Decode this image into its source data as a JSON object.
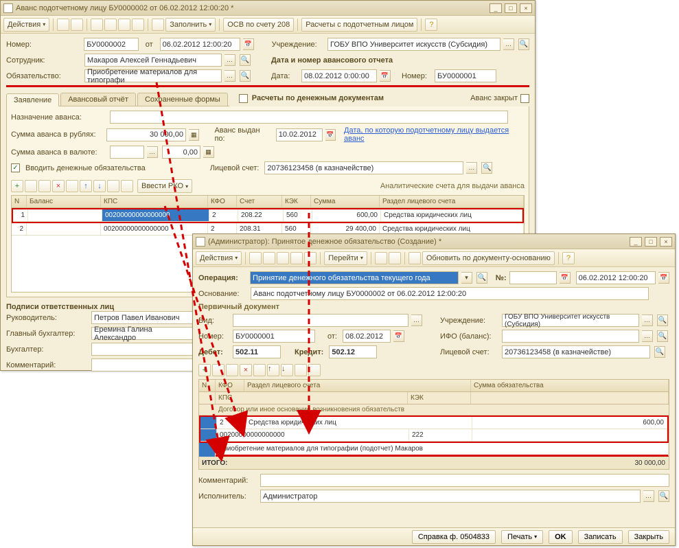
{
  "w1": {
    "title": "Аванс подотчетному лицу БУ0000002 от 06.02.2012 12:00:20 *",
    "toolbar": {
      "actions": "Действия",
      "fill": "Заполнить",
      "osv": "ОСВ по счету 208",
      "calc": "Расчеты с подотчетным лицом"
    },
    "nomer_lbl": "Номер:",
    "nomer": "БУ0000002",
    "ot_lbl": "от",
    "ot_date": "06.02.2012 12:00:20",
    "uchr_lbl": "Учреждение:",
    "uchr": "ГОБУ ВПО Университет искусств (Субсидия)",
    "sotr_lbl": "Сотрудник:",
    "sotr": "Макаров Алексей Геннадьевич",
    "avrep_title": "Дата и номер авансового отчета",
    "oblig_lbl": "Обязательство:",
    "oblig": "Приобретение материалов для типографи",
    "date_lbl": "Дата:",
    "date2": "08.02.2012 0:00:00",
    "nomer2_lbl": "Номер:",
    "nomer2": "БУ0000001",
    "tabs": {
      "t1": "Заявление",
      "t2": "Авансовый отчёт",
      "t3": "Сохраненные формы"
    },
    "rbd_lbl": "Расчеты по денежным документам",
    "closed_lbl": "Аванс закрыт",
    "nazn_lbl": "Назначение аванса:",
    "sum_rub_lbl": "Сумма аванса в рублях:",
    "sum_rub": "30 000,00",
    "vydan_lbl": "Аванс выдан по:",
    "vydan": "10.02.2012",
    "vydan_hint": "Дата, по которую подотчетному лицу выдается аванс",
    "sum_val_lbl": "Сумма аванса в валюте:",
    "sum_val": "0,00",
    "vvod_lbl": "Вводить денежные обязательства",
    "lich_lbl": "Лицевой счет:",
    "lich": "20736123458 (в казначействе)",
    "vvesti": "Ввести РКО",
    "anal": "Аналитические счета для выдачи аванса",
    "cols": {
      "n": "N",
      "bal": "Баланс",
      "kps": "КПС",
      "kfo": "КФО",
      "schet": "Счет",
      "kek": "КЭК",
      "sum": "Сумма",
      "razdel": "Раздел лицевого счета"
    },
    "rows": [
      {
        "n": "1",
        "bal": "",
        "kps": "00200000000000000",
        "kfo": "2",
        "schet": "208.22",
        "kek": "560",
        "sum": "600,00",
        "razdel": "Средства юридических лиц"
      },
      {
        "n": "2",
        "bal": "",
        "kps": "00200000000000000",
        "kfo": "2",
        "schet": "208.31",
        "kek": "560",
        "sum": "29 400,00",
        "razdel": "Средства юридических лиц"
      }
    ],
    "sig_title": "Подписи ответственных лиц",
    "ruk_lbl": "Руководитель:",
    "ruk": "Петров Павел Иванович",
    "gb_lbl": "Главный бухгалтер:",
    "gb": "Еремина Галина Александро",
    "buh_lbl": "Бухгалтер:",
    "kom_lbl": "Комментарий:"
  },
  "w2": {
    "title": "(Администратор): Принятое денежное обязательство (Создание) *",
    "toolbar": {
      "actions": "Действия",
      "goto": "Перейти",
      "refresh": "Обновить по документу-основанию"
    },
    "op_lbl": "Операция:",
    "op": "Принятие денежного обязательства текущего года",
    "num_lbl": "№:",
    "date": "06.02.2012 12:00:20",
    "osn_lbl": "Основание:",
    "osn": "Аванс подотчетному лицу БУ0000002 от 06.02.2012 12:00:20",
    "prim_title": "Первичный документ",
    "vid_lbl": "Вид:",
    "nomer_lbl": "Номер:",
    "nomer": "БУ0000001",
    "ot_lbl": "от:",
    "ot": "08.02.2012",
    "deb_lbl": "Дебет:",
    "deb": "502.11",
    "kred_lbl": "Кредит:",
    "kred": "502.12",
    "uchr_lbl": "Учреждение:",
    "uchr": "ГОБУ ВПО Университет искусств (Субсидия)",
    "ifo_lbl": "ИФО (баланс):",
    "lich_lbl": "Лицевой счет:",
    "lich": "20736123458 (в казначействе)",
    "cols": {
      "n": "N",
      "kfo": "КФО",
      "razdel": "Раздел лицевого счета",
      "sum": "Сумма обязательства",
      "kps": "КПС",
      "kek": "КЭК",
      "dog": "Договор или иное основание возникновения обязательств"
    },
    "r1": {
      "kfo": "2",
      "razdel": "Средства юридических лиц",
      "sum": "600,00",
      "kps": "00200000000000000",
      "kek": "222",
      "dog": "Приобретение материалов для типографии (подотчет) Макаров"
    },
    "itogo_lbl": "ИТОГО:",
    "itogo": "30 000,00",
    "kom_lbl": "Комментарий:",
    "isp_lbl": "Исполнитель:",
    "isp": "Администратор",
    "foot": {
      "spr": "Справка ф. 0504833",
      "print": "Печать",
      "ok": "OK",
      "save": "Записать",
      "close": "Закрыть"
    }
  }
}
